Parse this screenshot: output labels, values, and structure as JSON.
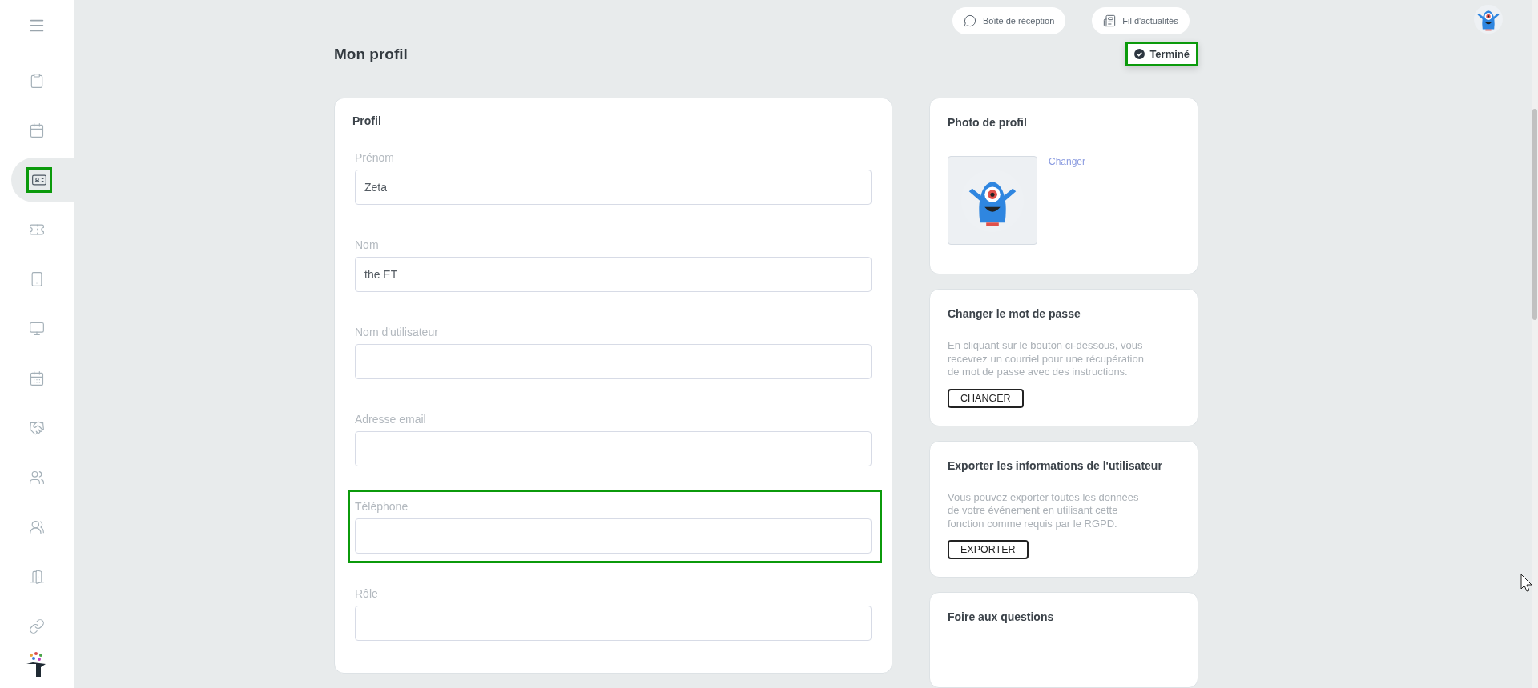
{
  "sidebar": {
    "items": [
      {
        "selected": false,
        "highlighted": false
      },
      {
        "selected": false,
        "highlighted": false
      },
      {
        "selected": true,
        "highlighted": true
      },
      {
        "selected": false,
        "highlighted": false
      },
      {
        "selected": false,
        "highlighted": false
      },
      {
        "selected": false,
        "highlighted": false
      },
      {
        "selected": false,
        "highlighted": false
      },
      {
        "selected": false,
        "highlighted": false
      },
      {
        "selected": false,
        "highlighted": false
      },
      {
        "selected": false,
        "highlighted": false
      },
      {
        "selected": false,
        "highlighted": false
      },
      {
        "selected": false,
        "highlighted": false
      }
    ]
  },
  "header": {
    "buttons": [
      {
        "label": "Boîte de réception"
      },
      {
        "label": "Fil d'actualités"
      }
    ]
  },
  "page": {
    "title": "Mon profil",
    "done_button": {
      "label": "Terminé",
      "highlighted": true
    }
  },
  "profile": {
    "title": "Profil",
    "fields": [
      {
        "label": "Prénom",
        "value": "Zeta",
        "highlighted": false
      },
      {
        "label": "Nom",
        "value": "the ET",
        "highlighted": false
      },
      {
        "label": "Nom d'utilisateur",
        "highlighted": false
      },
      {
        "label": "Adresse email",
        "highlighted": false
      },
      {
        "label": "Téléphone",
        "highlighted": true
      },
      {
        "label": "Rôle",
        "highlighted": false
      }
    ]
  },
  "cards": [
    {
      "kind": "photo",
      "title": "Photo de profil",
      "link": "Changer"
    },
    {
      "kind": "action",
      "title": "Changer le mot de passe",
      "text": "En cliquant sur le bouton ci-dessous, vous recevrez un courriel pour une récupération de mot de passe avec des instructions.",
      "button": "CHANGER"
    },
    {
      "kind": "action",
      "title": "Exporter les informations de l'utilisateur",
      "text": "Vous pouvez exporter toutes les données de votre événement en utilisant cette fonction comme requis par le RGPD.",
      "button": "EXPORTER"
    },
    {
      "kind": "title",
      "title": "Foire aux questions"
    }
  ]
}
